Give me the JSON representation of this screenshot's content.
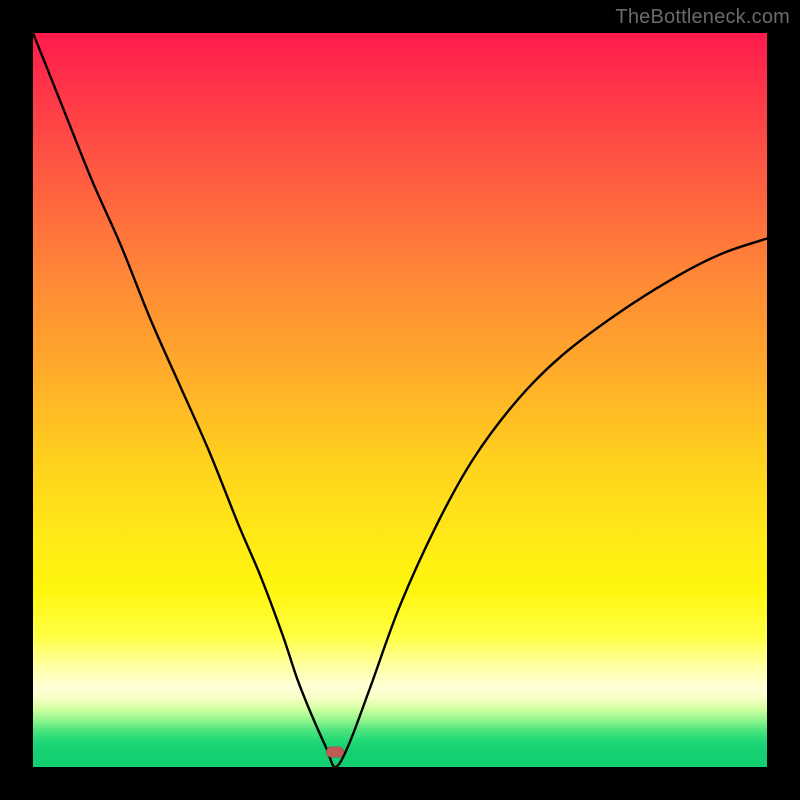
{
  "watermark": "TheBottleneck.com",
  "marker": {
    "x_percent": 41.2,
    "y_percent": 98.0,
    "color": "#c05a55"
  },
  "chart_data": {
    "type": "line",
    "title": "",
    "xlabel": "",
    "ylabel": "",
    "xlim": [
      0,
      100
    ],
    "ylim": [
      0,
      100
    ],
    "grid": false,
    "legend": false,
    "background": "rainbow-gradient (red top → green bottom)",
    "note": "V-shaped curve; minimum (~0) near x≈41; y rises to ~100 at x=0 and ~72 at x=100. Values estimated from pixels.",
    "series": [
      {
        "name": "bottleneck-curve",
        "x": [
          0,
          4,
          8,
          12,
          16,
          20,
          24,
          28,
          31,
          34,
          36,
          38,
          40,
          41.2,
          43,
          46,
          50,
          55,
          60,
          66,
          72,
          80,
          88,
          94,
          100
        ],
        "y": [
          100,
          90,
          80,
          71,
          61,
          52,
          43,
          33,
          26,
          18,
          12,
          7,
          2.5,
          0,
          3,
          11,
          22,
          33,
          42,
          50,
          56,
          62,
          67,
          70,
          72
        ]
      }
    ],
    "marker_point": {
      "x": 41.2,
      "y": 0
    }
  }
}
